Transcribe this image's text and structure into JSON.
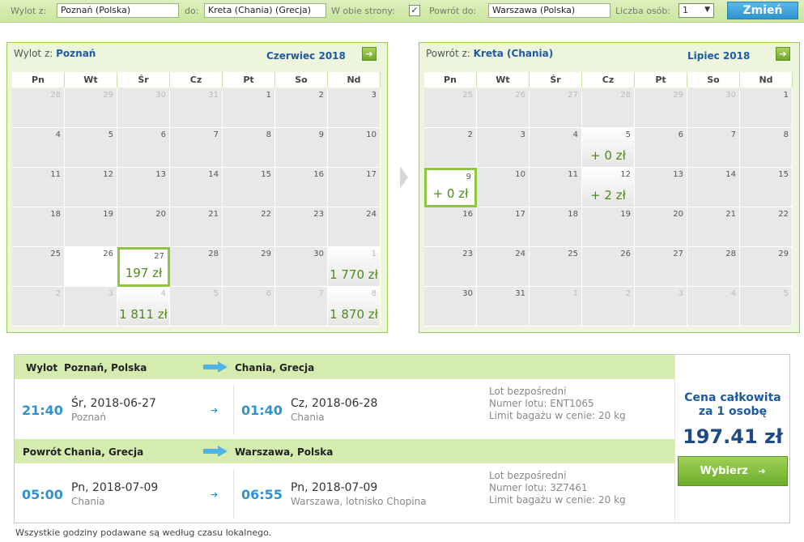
{
  "search": {
    "from_label": "Wylot z:",
    "from_value": "Poznań (Polska)",
    "to_label": "do:",
    "to_value": "Kreta (Chania) (Grecja)",
    "round_trip_label": "W obie strony:",
    "round_trip_checked": "✓",
    "return_label": "Powrót do:",
    "return_value": "Warszawa (Polska)",
    "persons_label": "Liczba osób:",
    "persons_value": "1",
    "change_button": "Zmień"
  },
  "weekdays": [
    "Pn",
    "Wt",
    "Śr",
    "Cz",
    "Pt",
    "So",
    "Nd"
  ],
  "outbound_calendar": {
    "from_label": "Wylot z:",
    "from_city": "Poznań",
    "month": "Czerwiec 2018",
    "rows": [
      [
        {
          "d": "28",
          "m": true
        },
        {
          "d": "29",
          "m": true
        },
        {
          "d": "30",
          "m": true
        },
        {
          "d": "31",
          "m": true
        },
        {
          "d": "1"
        },
        {
          "d": "2"
        },
        {
          "d": "3"
        }
      ],
      [
        {
          "d": "4"
        },
        {
          "d": "5"
        },
        {
          "d": "6"
        },
        {
          "d": "7"
        },
        {
          "d": "8"
        },
        {
          "d": "9"
        },
        {
          "d": "10"
        }
      ],
      [
        {
          "d": "11"
        },
        {
          "d": "12"
        },
        {
          "d": "13"
        },
        {
          "d": "14"
        },
        {
          "d": "15"
        },
        {
          "d": "16"
        },
        {
          "d": "17"
        }
      ],
      [
        {
          "d": "18"
        },
        {
          "d": "19"
        },
        {
          "d": "20"
        },
        {
          "d": "21"
        },
        {
          "d": "22"
        },
        {
          "d": "23"
        },
        {
          "d": "24"
        }
      ],
      [
        {
          "d": "25"
        },
        {
          "d": "26",
          "white": true
        },
        {
          "d": "27",
          "price": "197 zł",
          "sel": true
        },
        {
          "d": "28"
        },
        {
          "d": "29"
        },
        {
          "d": "30"
        },
        {
          "d": "1",
          "m": true,
          "price": "1 770 zł"
        }
      ],
      [
        {
          "d": "2",
          "m": true
        },
        {
          "d": "3",
          "m": true
        },
        {
          "d": "4",
          "m": true,
          "price": "1 811 zł"
        },
        {
          "d": "5",
          "m": true
        },
        {
          "d": "6",
          "m": true
        },
        {
          "d": "7",
          "m": true
        },
        {
          "d": "8",
          "m": true,
          "price": "1 870 zł"
        }
      ]
    ]
  },
  "return_calendar": {
    "from_label": "Powrót z:",
    "from_city": "Kreta (Chania)",
    "month": "Lipiec 2018",
    "rows": [
      [
        {
          "d": "25",
          "m": true
        },
        {
          "d": "26",
          "m": true
        },
        {
          "d": "27",
          "m": true
        },
        {
          "d": "28",
          "m": true
        },
        {
          "d": "29",
          "m": true
        },
        {
          "d": "30",
          "m": true
        },
        {
          "d": "1"
        }
      ],
      [
        {
          "d": "2"
        },
        {
          "d": "3"
        },
        {
          "d": "4"
        },
        {
          "d": "5",
          "price": "+ 0 zł"
        },
        {
          "d": "6"
        },
        {
          "d": "7"
        },
        {
          "d": "8"
        }
      ],
      [
        {
          "d": "9",
          "price": "+ 0 zł",
          "sel": true
        },
        {
          "d": "10"
        },
        {
          "d": "11"
        },
        {
          "d": "12",
          "price": "+ 2 zł"
        },
        {
          "d": "13"
        },
        {
          "d": "14"
        },
        {
          "d": "15"
        }
      ],
      [
        {
          "d": "16"
        },
        {
          "d": "17"
        },
        {
          "d": "18"
        },
        {
          "d": "19"
        },
        {
          "d": "20"
        },
        {
          "d": "21"
        },
        {
          "d": "22"
        }
      ],
      [
        {
          "d": "23"
        },
        {
          "d": "24"
        },
        {
          "d": "25"
        },
        {
          "d": "26"
        },
        {
          "d": "27"
        },
        {
          "d": "28"
        },
        {
          "d": "29"
        }
      ],
      [
        {
          "d": "30"
        },
        {
          "d": "31"
        },
        {
          "d": "1",
          "m": true
        },
        {
          "d": "2",
          "m": true
        },
        {
          "d": "3",
          "m": true
        },
        {
          "d": "4",
          "m": true
        },
        {
          "d": "5",
          "m": true
        }
      ]
    ]
  },
  "outbound": {
    "label": "Wylot",
    "from": "Poznań, Polska",
    "to": "Chania, Grecja",
    "dep_time": "21:40",
    "dep_date": "Śr, 2018-06-27",
    "dep_place": "Poznań",
    "arr_time": "01:40",
    "arr_date": "Cz, 2018-06-28",
    "arr_place": "Chania",
    "info1": "Lot bezpośredni",
    "info2": "Numer lotu: ENT1065",
    "info3": "Limit bagażu w cenie: 20 kg"
  },
  "inbound": {
    "label": "Powrót",
    "from": "Chania, Grecja",
    "to": "Warszawa, Polska",
    "dep_time": "05:00",
    "dep_date": "Pn, 2018-07-09",
    "dep_place": "Chania",
    "arr_time": "06:55",
    "arr_date": "Pn, 2018-07-09",
    "arr_place": "Warszawa, lotnisko Chopina",
    "info1": "Lot bezpośredni",
    "info2": "Numer lotu: 3Z7461",
    "info3": "Limit bagażu w cenie: 20 kg"
  },
  "price": {
    "label_line1": "Cena całkowita",
    "label_line2": "za 1 osobę",
    "total": "197.41 zł",
    "button": "Wybierz",
    "button_icon": "➔"
  },
  "footnote": "Wszystkie godziny podawane są według czasu lokalnego."
}
